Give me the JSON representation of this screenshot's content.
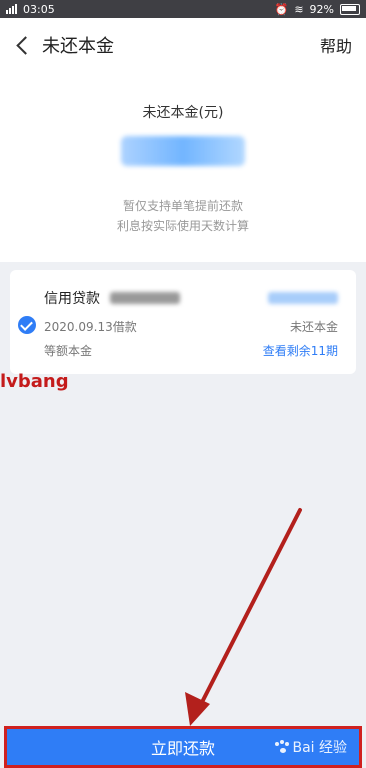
{
  "status_bar": {
    "time": "03:05",
    "battery": "92%"
  },
  "header": {
    "title": "未还本金",
    "help": "帮助"
  },
  "summary": {
    "label": "未还本金(元)",
    "note_line1": "暂仅支持单笔提前还款",
    "note_line2": "利息按实际使用天数计算"
  },
  "loan": {
    "name": "信用贷款",
    "date": "2020.09.13借款",
    "method": "等额本金",
    "remaining_label": "未还本金",
    "view_remaining": "查看剩余11期"
  },
  "watermark": "lvbang",
  "repay_button": {
    "label": "立即还款",
    "badge": "Bai 经验"
  },
  "colors": {
    "accent": "#2f7df6",
    "highlight": "#d0211f"
  }
}
